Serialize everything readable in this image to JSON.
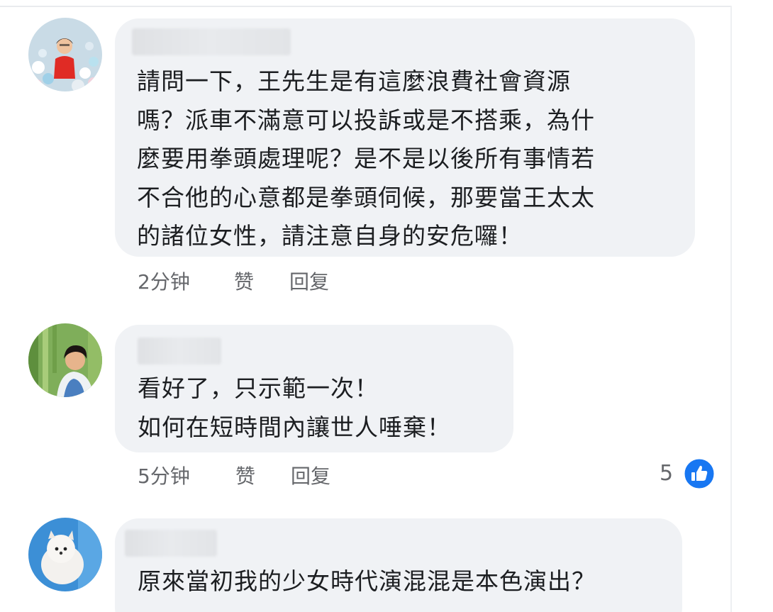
{
  "comments": [
    {
      "text": "請問一下，王先生是有這麼浪費社會資源\n嗎？派車不滿意可以投訴或是不搭乘，為什\n麼要用拳頭處理呢？是不是以後所有事情若\n不合他的心意都是拳頭伺候，那要當王太太\n的諸位女性，請注意自身的安危囉！",
      "time": "2分钟",
      "like_label": "赞",
      "reply_label": "回复"
    },
    {
      "text": "看好了，只示範一次！\n如何在短時間內讓世人唾棄！",
      "time": "5分钟",
      "like_label": "赞",
      "reply_label": "回复",
      "reaction_count": "5"
    },
    {
      "text": "原來當初我的少女時代演混混是本色演出？"
    }
  ],
  "colors": {
    "bubble": "#f0f2f5",
    "text": "#1c1e21",
    "meta": "#65676b",
    "like_badge": "#1877f2"
  },
  "icons": {
    "reaction": "thumbs-up-icon"
  }
}
